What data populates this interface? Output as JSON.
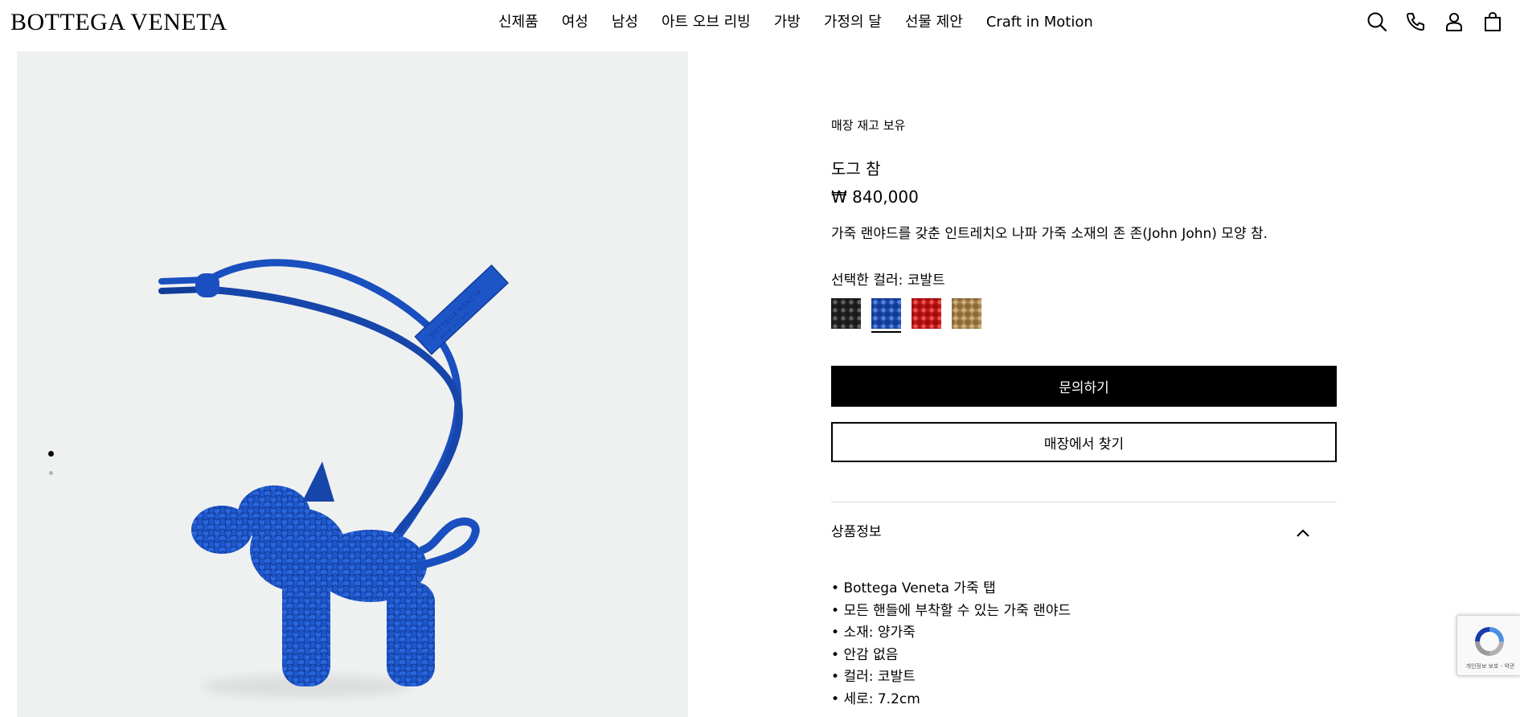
{
  "header": {
    "logo": "BOTTEGA VENETA",
    "nav": [
      "신제품",
      "여성",
      "남성",
      "아트 오브 리빙",
      "가방",
      "가정의 달",
      "선물 제안",
      "Craft in Motion"
    ],
    "icons": [
      "search-icon",
      "phone-icon",
      "account-icon",
      "shopping-bag-icon"
    ]
  },
  "product": {
    "stock_status": "매장 재고 보유",
    "name": "도그 참",
    "price": "₩ 840,000",
    "description": "가죽 랜야드를 갖춘 인트레치오 나파 가죽 소재의 존 존(John John) 모양 참.",
    "selected_color_label": "선택한 컬러: 코발트",
    "swatches": [
      {
        "color": "#222222",
        "name": "black"
      },
      {
        "color": "#1a4fbf",
        "name": "cobalt",
        "selected": true
      },
      {
        "color": "#d41414",
        "name": "red"
      },
      {
        "color": "#b68d4f",
        "name": "tan"
      }
    ],
    "inquire_label": "문의하기",
    "find_in_store_label": "매장에서 찾기",
    "details_title": "상품정보",
    "details": [
      "Bottega Veneta 가죽 탭",
      "모든 핸들에 부착할 수 있는 가죽 랜야드",
      "소재: 양가죽",
      "안감 없음",
      "컬러: 코발트",
      "세로: 7.2cm"
    ]
  },
  "gallery": {
    "image": "cobalt-intrecciato-dog-charm",
    "slides": 2,
    "active_slide": 1
  },
  "recaptcha": {
    "text": "개인정보 보호 - 약관"
  },
  "colors": {
    "accent": "#000000",
    "image_bg": "#eff1f1",
    "cobalt": "#1a4fbf"
  }
}
